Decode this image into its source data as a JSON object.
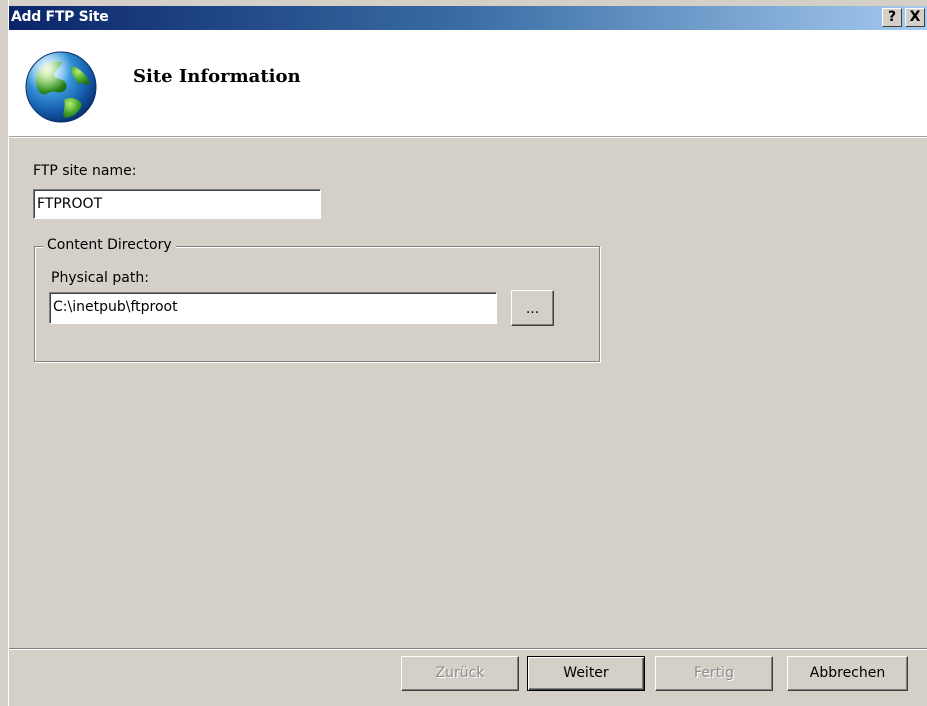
{
  "window": {
    "title": "Add FTP Site",
    "help_button": "?",
    "close_button": "X"
  },
  "header": {
    "title": "Site Information",
    "icon": "globe-icon"
  },
  "form": {
    "site_name_label": "FTP site name:",
    "site_name_value": "FTPROOT",
    "content_directory_legend": "Content Directory",
    "physical_path_label": "Physical path:",
    "physical_path_value": "C:\\inetpub\\ftproot",
    "browse_label": "..."
  },
  "footer": {
    "back_label": "Zurück",
    "next_label": "Weiter",
    "finish_label": "Fertig",
    "cancel_label": "Abbrechen"
  },
  "colors": {
    "titlebar_start": "#0a246a",
    "titlebar_end": "#a6caf0",
    "dialog_bg": "#d4d0c8",
    "disabled_text": "#8c8c8c"
  }
}
